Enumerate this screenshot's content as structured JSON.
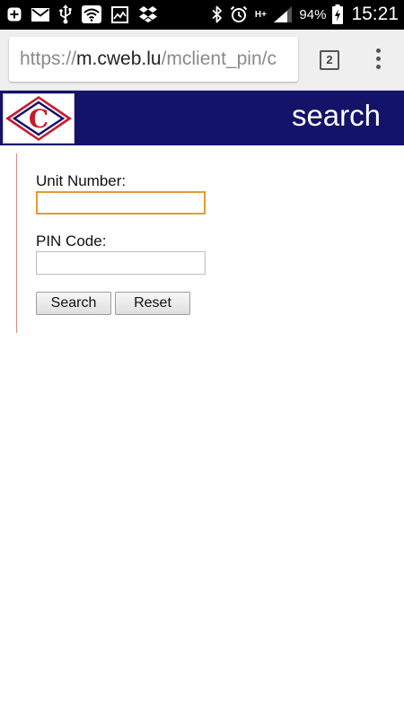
{
  "status_bar": {
    "battery_percent": "94%",
    "time": "15:21",
    "network_type": "H+",
    "left_icons": [
      "add-icon",
      "email-icon",
      "usb-icon",
      "wifi-icon",
      "image-icon",
      "dropbox-icon"
    ],
    "right_icons": [
      "bluetooth-icon",
      "alarm-icon",
      "network-type-icon",
      "signal-icon",
      "battery-charging-icon"
    ]
  },
  "browser": {
    "url_scheme": "https://",
    "url_host": "m.cweb.lu",
    "url_path": "/mclient_pin/c",
    "tab_count": "2",
    "menu_icon": "more-vert-icon"
  },
  "header": {
    "logo": "company-logo",
    "logo_letter": "C",
    "title": "search",
    "background_color": "#13136a",
    "logo_red": "#c51d2e"
  },
  "form": {
    "unit_number_label": "Unit Number:",
    "unit_number_value": "",
    "pin_code_label": "PIN Code:",
    "pin_code_value": "",
    "search_label": "Search",
    "reset_label": "Reset",
    "focus_color": "#e59a33"
  }
}
